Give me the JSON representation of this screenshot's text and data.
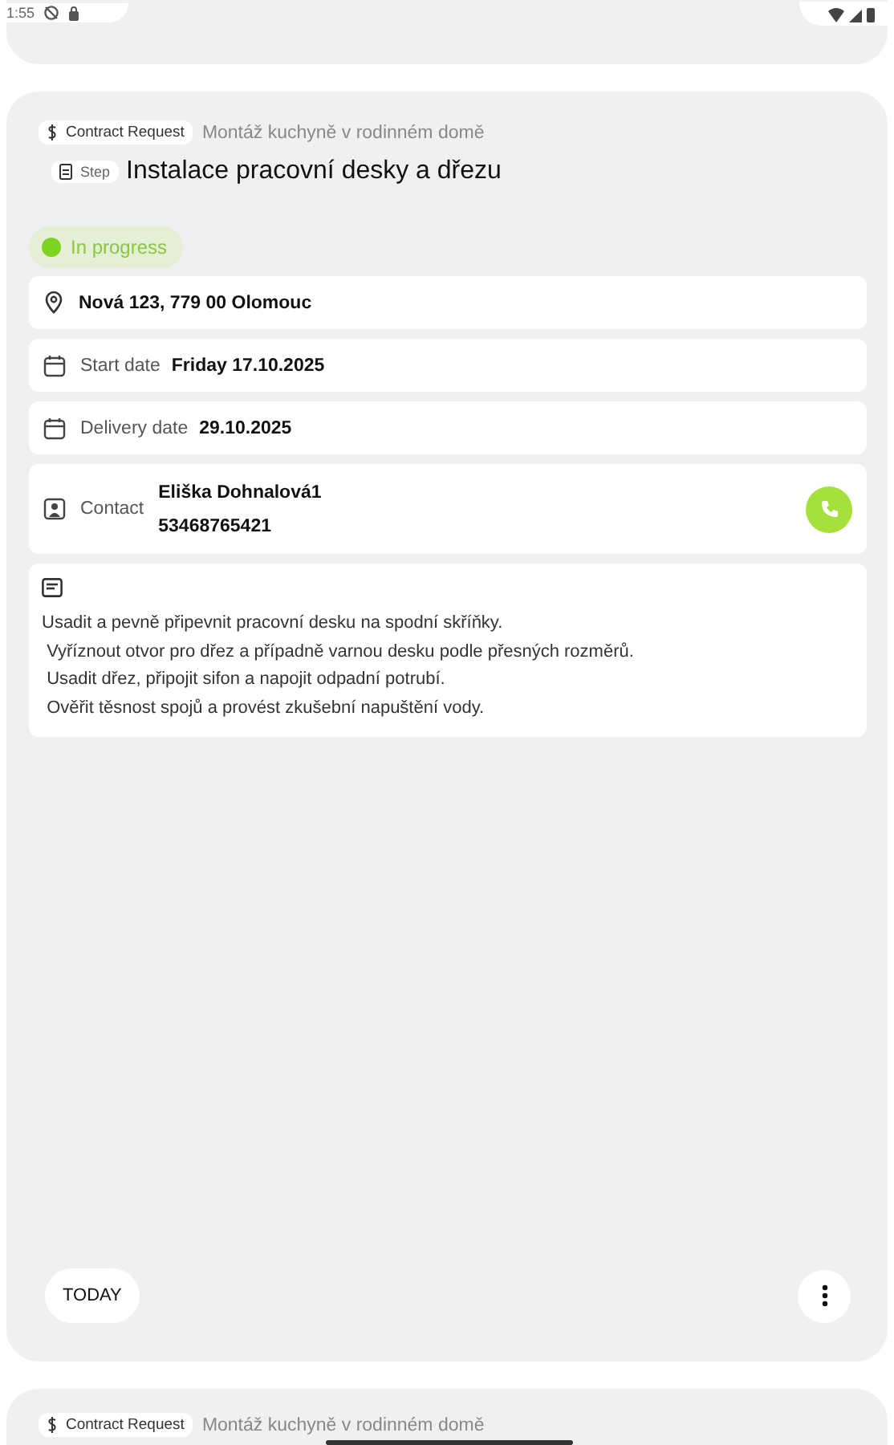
{
  "status_bar": {
    "time": "1:55"
  },
  "card": {
    "request_chip": "Contract Request",
    "request_title": "Montáž kuchyně v rodinném domě",
    "step_chip": "Step",
    "step_title": "Instalace pracovní desky a dřezu",
    "status": {
      "label": "In progress",
      "kind": "in_progress"
    },
    "address": "Nová 123, 779 00 Olomouc",
    "start_date": {
      "label": "Start date",
      "value": "Friday 17.10.2025"
    },
    "delivery_date": {
      "label": "Delivery date",
      "value": "29.10.2025"
    },
    "contact": {
      "label": "Contact",
      "name": "Eliška Dohnalová1",
      "phone": "53468765421"
    },
    "description": "Usadit a pevně připevnit pracovní desku na spodní skříňky.\n Vyříznout otvor pro dřez a případně varnou desku podle přesných rozměrů.\n Usadit dřez, připojit sifon a napojit odpadní potrubí.\n Ověřit těsnost spojů a provést zkušební napuštění vody.",
    "today_button": "TODAY"
  },
  "next_card": {
    "request_chip": "Contract Request",
    "request_title": "Montáž kuchyně v rodinném domě"
  }
}
